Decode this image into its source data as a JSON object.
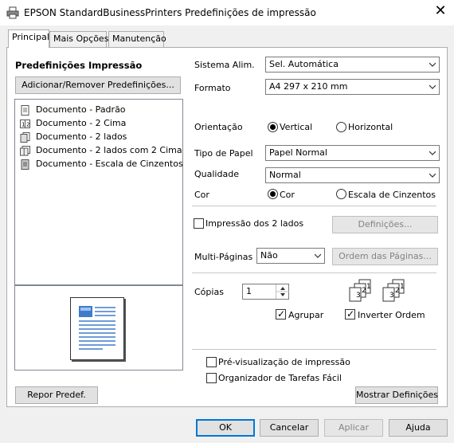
{
  "window": {
    "title": "EPSON StandardBusinessPrinters Predefinições de impressão",
    "close_glyph": "✕"
  },
  "tabs": [
    {
      "label": "Principal",
      "active": true
    },
    {
      "label": "Mais Opções",
      "active": false
    },
    {
      "label": "Manutenção",
      "active": false
    }
  ],
  "presets": {
    "heading": "Predefinições Impressão",
    "add_remove_label": "Adicionar/Remover Predefinições...",
    "items": [
      {
        "label": "Documento - Padrão",
        "icon": "document-icon"
      },
      {
        "label": "Documento - 2 Cima",
        "icon": "two-up-icon"
      },
      {
        "label": "Documento - 2 lados",
        "icon": "two-sided-icon"
      },
      {
        "label": "Documento - 2 lados com 2 Cima",
        "icon": "two-sided-two-up-icon"
      },
      {
        "label": "Documento - Escala de Cinzentos",
        "icon": "grayscale-document-icon"
      }
    ],
    "reset_label": "Repor Predef."
  },
  "settings": {
    "paper_source": {
      "label": "Sistema Alim.",
      "value": "Sel. Automática"
    },
    "paper_size": {
      "label": "Formato",
      "value": "A4 297 x 210 mm"
    },
    "orientation": {
      "label": "Orientação",
      "options": [
        "Vertical",
        "Horizontal"
      ],
      "selected": "Vertical"
    },
    "paper_type": {
      "label": "Tipo de Papel",
      "value": "Papel Normal"
    },
    "quality": {
      "label": "Qualidade",
      "value": "Normal"
    },
    "color": {
      "label": "Cor",
      "options": [
        "Cor",
        "Escala de Cinzentos"
      ],
      "selected": "Cor"
    },
    "duplex": {
      "label": "Impressão dos 2 lados",
      "checked": false,
      "settings_label": "Definições..."
    },
    "multipage": {
      "label": "Multi-Páginas",
      "value": "Não",
      "order_label": "Ordem das Páginas..."
    },
    "copies": {
      "label": "Cópias",
      "value": "1"
    },
    "collate": {
      "label": "Agrupar",
      "checked": true
    },
    "reverse": {
      "label": "Inverter Ordem",
      "checked": true
    },
    "print_preview": {
      "label": "Pré-visualização de impressão",
      "checked": false
    },
    "job_arranger": {
      "label": "Organizador de Tarefas Fácil",
      "checked": false
    },
    "show_settings_label": "Mostrar Definições"
  },
  "collate_icon_digits": [
    "1",
    "2",
    "3"
  ],
  "reverse_icon_digits": [
    "1",
    "2",
    "3"
  ],
  "footer": {
    "ok": "OK",
    "cancel": "Cancelar",
    "apply": "Aplicar",
    "help": "Ajuda"
  },
  "colors": {
    "focus_border": "#0078d7",
    "preview_blue": "#3e7ccb"
  }
}
